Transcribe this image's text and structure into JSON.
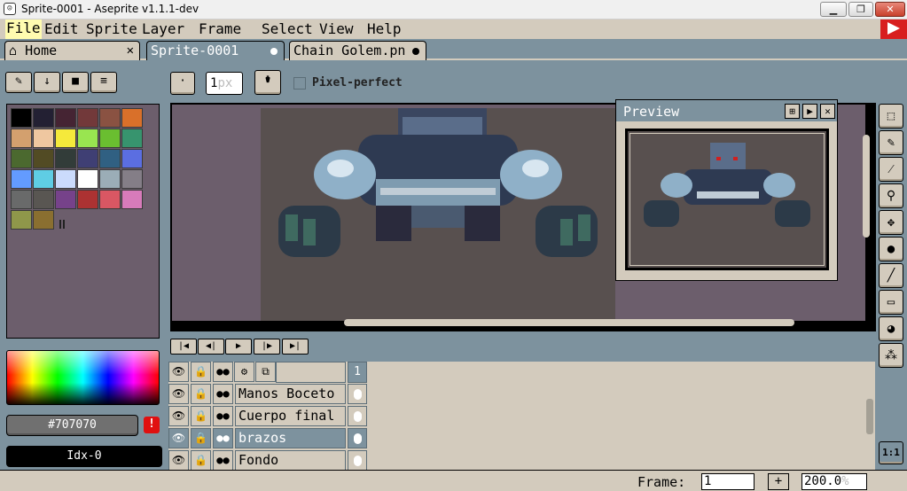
{
  "window": {
    "title": "Sprite-0001 - Aseprite v1.1.1-dev",
    "minimize": "▁",
    "maximize": "❐",
    "close": "✕"
  },
  "menu": [
    "File",
    "Edit",
    "Sprite",
    "Layer",
    "Frame",
    "Select",
    "View",
    "Help"
  ],
  "tabs": [
    {
      "label": "Home",
      "icon": "home-icon"
    },
    {
      "label": "Sprite-0001"
    },
    {
      "label": "Chain Golem.pn"
    }
  ],
  "context_bar": {
    "brush_size": "1",
    "brush_unit": "px",
    "pixel_perfect_label": "Pixel-perfect"
  },
  "palette": {
    "colors": [
      "#000000",
      "#232033",
      "#452433",
      "#72393a",
      "#8a5242",
      "#d9702a",
      "#d3a06e",
      "#efc7a0",
      "#f5e93b",
      "#99e550",
      "#6abe30",
      "#37946e",
      "#4b692f",
      "#524b24",
      "#323c39",
      "#3f3f74",
      "#306082",
      "#5b6ee1",
      "#639bff",
      "#5fcde4",
      "#cbdbfc",
      "#ffffff",
      "#9badb7",
      "#847e87",
      "#696a6a",
      "#595652",
      "#76428a",
      "#ac3232",
      "#d95763",
      "#d77bba",
      "#8f974a",
      "#8a6f30"
    ],
    "selected_hex": "#707070",
    "index": "Idx-0"
  },
  "preview": {
    "title": "Preview"
  },
  "tools": [
    "marquee-tool-icon",
    "pencil-tool-icon",
    "eyedropper-tool-icon",
    "zoom-tool-icon",
    "move-tool-icon",
    "fill-tool-icon",
    "line-tool-icon",
    "rectangle-tool-icon",
    "contour-tool-icon",
    "blur-tool-icon"
  ],
  "timeline": {
    "frame_number": "1",
    "layers": [
      "Manos Boceto",
      "Cuerpo final",
      "brazos",
      "Fondo"
    ],
    "selected_layer": "brazos"
  },
  "status": {
    "frame_label": "Frame:",
    "frame_value": "1",
    "add_frame": "+",
    "zoom_value": "200.0",
    "zoom_unit": "%",
    "zoom_1_1": "1:1"
  }
}
